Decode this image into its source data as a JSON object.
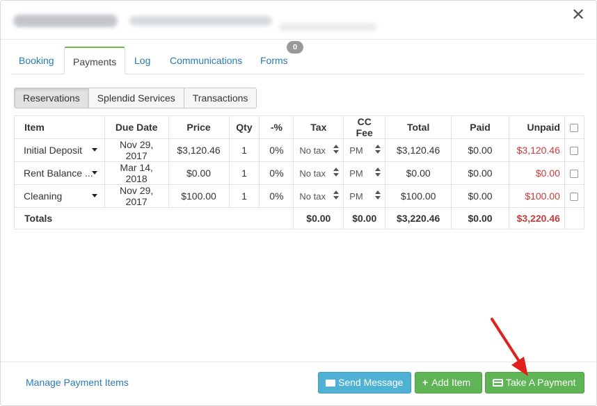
{
  "tabs": [
    {
      "label": "Booking"
    },
    {
      "label": "Payments"
    },
    {
      "label": "Log"
    },
    {
      "label": "Communications"
    },
    {
      "label": "Forms",
      "badge": "0"
    }
  ],
  "subtabs": [
    {
      "label": "Reservations"
    },
    {
      "label": "Splendid Services"
    },
    {
      "label": "Transactions"
    }
  ],
  "table": {
    "headers": [
      "Item",
      "Due Date",
      "Price",
      "Qty",
      "-%",
      "Tax",
      "CC Fee",
      "Total",
      "Paid",
      "Unpaid"
    ],
    "rows": [
      {
        "item": "Initial Deposit",
        "due": "Nov 29, 2017",
        "price": "$3,120.46",
        "qty": "1",
        "pct": "0%",
        "tax": "No tax",
        "ccfee": "PM",
        "total": "$3,120.46",
        "paid": "$0.00",
        "unpaid": "$3,120.46"
      },
      {
        "item": "Rent Balance ...",
        "due": "Mar 14, 2018",
        "price": "$0.00",
        "qty": "1",
        "pct": "0%",
        "tax": "No tax",
        "ccfee": "PM",
        "total": "$0.00",
        "paid": "$0.00",
        "unpaid": "$0.00"
      },
      {
        "item": "Cleaning",
        "due": "Nov 29, 2017",
        "price": "$100.00",
        "qty": "1",
        "pct": "0%",
        "tax": "No tax",
        "ccfee": "PM",
        "total": "$100.00",
        "paid": "$0.00",
        "unpaid": "$100.00"
      }
    ],
    "totals": {
      "label": "Totals",
      "tax": "$0.00",
      "ccfee": "$0.00",
      "total": "$3,220.46",
      "paid": "$0.00",
      "unpaid": "$3,220.46"
    }
  },
  "footer": {
    "manage_link": "Manage Payment Items",
    "send_message": "Send Message",
    "add_item": "Add Item",
    "take_payment": "Take A Payment"
  },
  "colors": {
    "link": "#2a7ab4",
    "unpaid": "#c63b3b",
    "info_button": "#4fb1d4",
    "success_button": "#5fb455",
    "active_tab_accent": "#6bb84f",
    "annotation_arrow": "#e0201c"
  },
  "icons": {
    "close": "close-icon",
    "send_message": "envelope-icon",
    "add_item": "plus-icon",
    "take_payment": "credit-card-icon"
  }
}
